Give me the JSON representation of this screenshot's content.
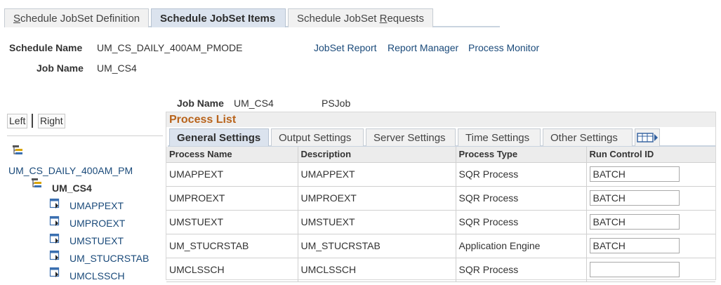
{
  "top_tabs": [
    {
      "pre": "",
      "u": "S",
      "post": "chedule JobSet Definition"
    },
    {
      "pre": "Schedule JobSet Items",
      "u": "",
      "post": ""
    },
    {
      "pre": "Schedule JobSet ",
      "u": "R",
      "post": "equests"
    }
  ],
  "header": {
    "schedule_name_label": "Schedule Name",
    "schedule_name_value": "UM_CS_DAILY_400AM_PMODE",
    "job_name_label": "Job Name",
    "job_name_value": "UM_CS4",
    "links": [
      "JobSet Report",
      "Report Manager",
      "Process Monitor"
    ]
  },
  "left_nav": {
    "left_label": "Left",
    "right_label": "Right",
    "tree": {
      "root": "UM_CS_DAILY_400AM_PM",
      "job": "UM_CS4",
      "items": [
        "UMAPPEXT",
        "UMPROEXT",
        "UMSTUEXT",
        "UM_STUCRSTAB",
        "UMCLSSCH"
      ]
    }
  },
  "job_info": {
    "label": "Job Name",
    "value": "UM_CS4",
    "type": "PSJob"
  },
  "process_list": {
    "title": "Process List",
    "tabs": [
      "General Settings",
      "Output Settings",
      "Server Settings",
      "Time Settings",
      "Other Settings"
    ],
    "columns": [
      "Process Name",
      "Description",
      "Process Type",
      "Run Control ID"
    ],
    "rows": [
      {
        "name": "UMAPPEXT",
        "desc": "UMAPPEXT",
        "type": "SQR Process",
        "rc": "BATCH"
      },
      {
        "name": "UMPROEXT",
        "desc": "UMPROEXT",
        "type": "SQR Process",
        "rc": "BATCH"
      },
      {
        "name": "UMSTUEXT",
        "desc": "UMSTUEXT",
        "type": "SQR Process",
        "rc": "BATCH"
      },
      {
        "name": "UM_STUCRSTAB",
        "desc": "UM_STUCRSTAB",
        "type": "Application Engine",
        "rc": "BATCH"
      },
      {
        "name": "UMCLSSCH",
        "desc": "UMCLSSCH",
        "type": "SQR Process",
        "rc": ""
      }
    ]
  },
  "colors": {
    "link": "#1a4a7a",
    "title_orange": "#b8631b",
    "tab_active": "#dbe3ee"
  },
  "icons": {
    "tree_root": "jobset-tree-icon",
    "tree_job": "job-tree-icon",
    "tree_process": "process-tree-icon",
    "grid_tab": "show-all-columns-icon"
  }
}
